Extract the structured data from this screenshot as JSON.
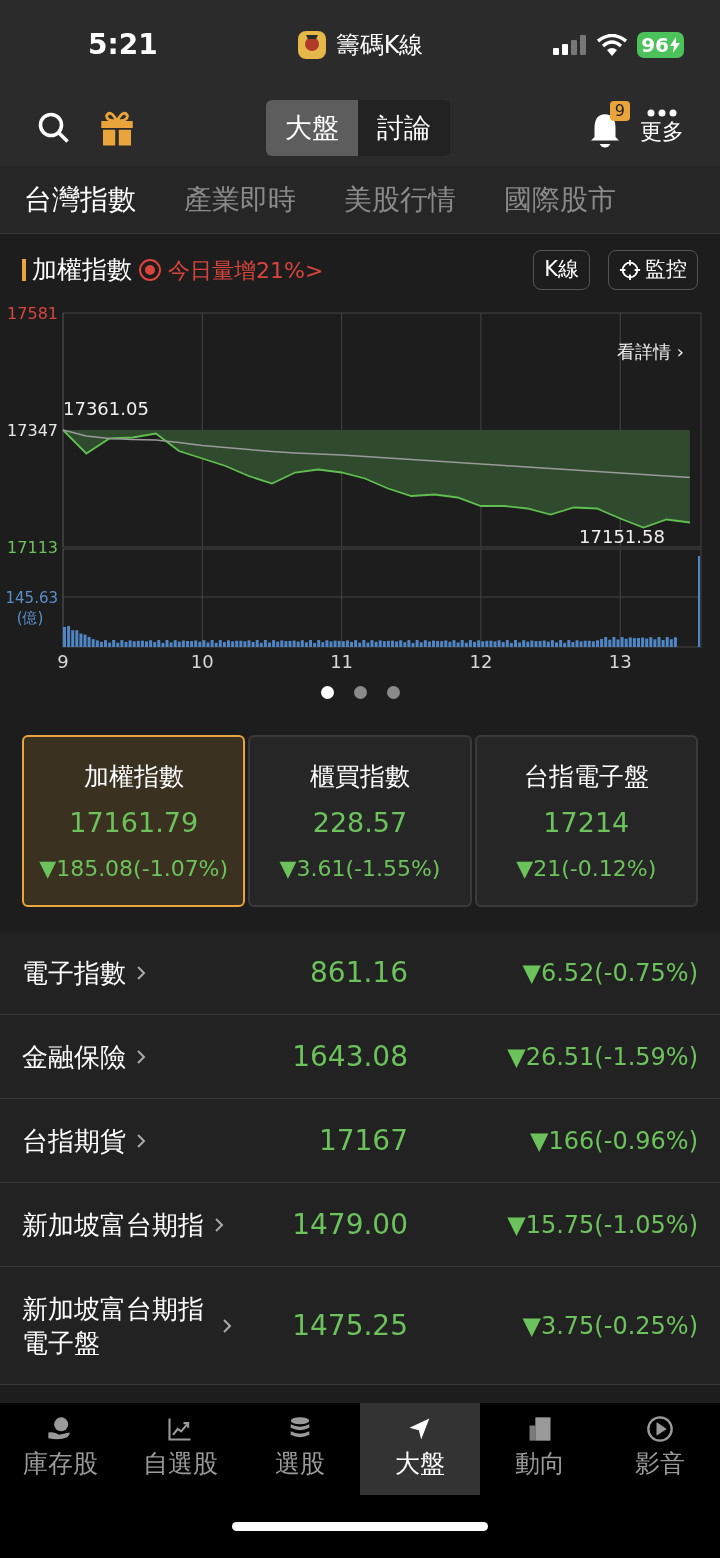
{
  "status_bar": {
    "time": "5:21",
    "app_title": "籌碼K線",
    "battery": "96"
  },
  "header": {
    "segments": [
      {
        "label": "大盤",
        "selected": true
      },
      {
        "label": "討論",
        "selected": false
      }
    ],
    "notification_count": "9",
    "more_label": "更多"
  },
  "tabs": [
    {
      "label": "台灣指數",
      "selected": true
    },
    {
      "label": "產業即時",
      "selected": false
    },
    {
      "label": "美股行情",
      "selected": false
    },
    {
      "label": "國際股市",
      "selected": false
    }
  ],
  "index_bar": {
    "title": "加權指數",
    "alert": "今日量增21%>",
    "buttons": [
      {
        "kind": "text",
        "label": "K線"
      },
      {
        "kind": "monitor",
        "label": "監控"
      }
    ]
  },
  "chart": {
    "details_link": "看詳情 ›",
    "high_label": "17361.05",
    "low_label": "17151.58",
    "volume_label": "145.63",
    "volume_unit": "(億)",
    "chart_data": {
      "type": "line",
      "x": [
        9,
        9.167,
        9.333,
        9.5,
        9.667,
        9.833,
        10,
        10.167,
        10.333,
        10.5,
        10.667,
        10.833,
        11,
        11.167,
        11.333,
        11.5,
        11.667,
        11.833,
        12,
        12.167,
        12.333,
        12.5,
        12.667,
        12.833,
        13,
        13.167,
        13.333,
        13.5
      ],
      "series": [
        {
          "color": "#5fbf4f",
          "values": [
            17347,
            17300,
            17330,
            17332,
            17340,
            17305,
            17290,
            17275,
            17255,
            17240,
            17262,
            17268,
            17262,
            17250,
            17230,
            17215,
            17218,
            17212,
            17195,
            17195,
            17190,
            17178,
            17192,
            17190,
            17170,
            17152,
            17168,
            17162
          ]
        },
        {
          "color": "#9a9a9a",
          "values": [
            17347,
            17335,
            17330,
            17328,
            17327,
            17322,
            17316,
            17312,
            17308,
            17304,
            17301,
            17299,
            17297,
            17294,
            17291,
            17288,
            17285,
            17282,
            17279,
            17276,
            17273,
            17270,
            17267,
            17264,
            17261,
            17258,
            17255,
            17252
          ]
        }
      ],
      "xlim": [
        9,
        13.58
      ],
      "ylim": [
        17113,
        17581
      ],
      "xticks": [
        9,
        10,
        11,
        12,
        13
      ],
      "yticks": [
        17113,
        17347,
        17581
      ],
      "grid": true
    }
  },
  "pager": [
    {
      "selected": true
    },
    {
      "selected": false
    },
    {
      "selected": false
    }
  ],
  "index_cards": [
    {
      "name": "加權指數",
      "value": "17161.79",
      "change": "▼185.08(-1.07%)",
      "selected": true
    },
    {
      "name": "櫃買指數",
      "value": "228.57",
      "change": "▼3.61(-1.55%)",
      "selected": false
    },
    {
      "name": "台指電子盤",
      "value": "17214",
      "change": "▼21(-0.12%)",
      "selected": false
    }
  ],
  "quotes": [
    {
      "name": "電子指數",
      "value": "861.16",
      "change": "▼6.52(-0.75%)"
    },
    {
      "name": "金融保險",
      "value": "1643.08",
      "change": "▼26.51(-1.59%)"
    },
    {
      "name": "台指期貨",
      "value": "17167",
      "change": "▼166(-0.96%)"
    },
    {
      "name": "新加坡富台期指",
      "value": "1479.00",
      "change": "▼15.75(-1.05%)"
    },
    {
      "name": "新加坡富台期指電子盤",
      "value": "1475.25",
      "change": "▼3.75(-0.25%)"
    }
  ],
  "bottom_nav": [
    {
      "kind": "holdings",
      "label": "庫存股",
      "selected": false
    },
    {
      "kind": "watchlist",
      "label": "自選股",
      "selected": false
    },
    {
      "kind": "screener",
      "label": "選股",
      "selected": false
    },
    {
      "kind": "market",
      "label": "大盤",
      "selected": true
    },
    {
      "kind": "news",
      "label": "動向",
      "selected": false
    },
    {
      "kind": "video",
      "label": "影音",
      "selected": false
    }
  ]
}
